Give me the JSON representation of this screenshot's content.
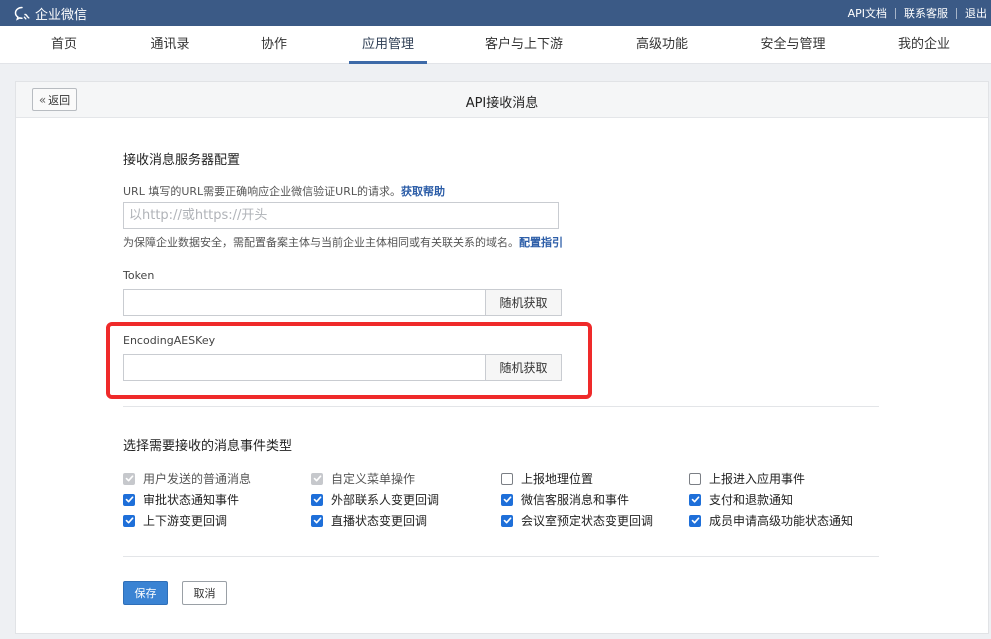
{
  "app": {
    "logo_text": "企业微信",
    "top_links": [
      "API文档",
      "联系客服",
      "退出"
    ]
  },
  "nav": {
    "tabs": [
      "首页",
      "通讯录",
      "协作",
      "应用管理",
      "客户与上下游",
      "高级功能",
      "安全与管理",
      "我的企业"
    ],
    "active": "应用管理"
  },
  "panel": {
    "back_label": "返回",
    "title": "API接收消息"
  },
  "server_config": {
    "section_title": "接收消息服务器配置",
    "url_hint": "URL  填写的URL需要正确响应企业微信验证URL的请求。",
    "url_hint_link": "获取帮助",
    "url_placeholder": "以http://或https://开头",
    "url_value": "",
    "domain_hint": "为保障企业数据安全，需配置备案主体与当前企业主体相同或有关联关系的域名。",
    "domain_hint_link": "配置指引",
    "token_label": "Token",
    "token_value": "",
    "aes_label": "EncodingAESKey",
    "aes_value": "",
    "random_label": "随机获取"
  },
  "events": {
    "section_title": "选择需要接收的消息事件类型",
    "items": [
      {
        "label": "用户发送的普通消息",
        "checked": true,
        "disabled": true
      },
      {
        "label": "自定义菜单操作",
        "checked": true,
        "disabled": true
      },
      {
        "label": "上报地理位置",
        "checked": false,
        "disabled": false
      },
      {
        "label": "上报进入应用事件",
        "checked": false,
        "disabled": false
      },
      {
        "label": "审批状态通知事件",
        "checked": true,
        "disabled": false
      },
      {
        "label": "外部联系人变更回调",
        "checked": true,
        "disabled": false
      },
      {
        "label": "微信客服消息和事件",
        "checked": true,
        "disabled": false
      },
      {
        "label": "支付和退款通知",
        "checked": true,
        "disabled": false
      },
      {
        "label": "上下游变更回调",
        "checked": true,
        "disabled": false
      },
      {
        "label": "直播状态变更回调",
        "checked": true,
        "disabled": false
      },
      {
        "label": "会议室预定状态变更回调",
        "checked": true,
        "disabled": false
      },
      {
        "label": "成员申请高级功能状态通知",
        "checked": true,
        "disabled": false
      }
    ]
  },
  "actions": {
    "save_label": "保存",
    "cancel_label": "取消"
  },
  "colors": {
    "topbar": "#3b5a86",
    "accent": "#3d6aa8",
    "checkbox_checked": "#1e6fd9",
    "highlight_box": "#ef2a2a",
    "primary_button": "#3a83d3"
  },
  "icons": [
    "chat-bubble-logo-icon",
    "double-chevron-left-icon",
    "checkmark-icon"
  ]
}
